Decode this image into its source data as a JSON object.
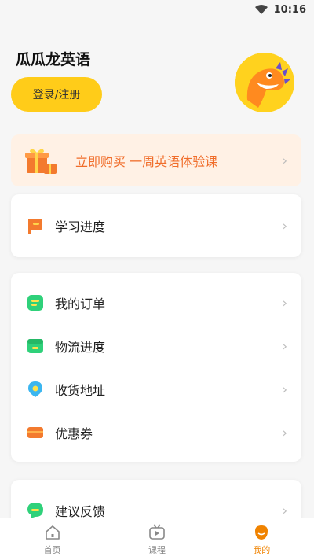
{
  "status": {
    "time": "10:16"
  },
  "header": {
    "app_name": "瓜瓜龙英语",
    "login_label": "登录/注册"
  },
  "promo": {
    "text": "立即购买 一周英语体验课"
  },
  "card1": {
    "items": [
      {
        "label": "学习进度"
      }
    ]
  },
  "card2": {
    "items": [
      {
        "label": "我的订单"
      },
      {
        "label": "物流进度"
      },
      {
        "label": "收货地址"
      },
      {
        "label": "优惠券"
      }
    ]
  },
  "card3": {
    "items": [
      {
        "label": "建议反馈"
      }
    ]
  },
  "tabbar": {
    "tabs": [
      {
        "label": "首页"
      },
      {
        "label": "课程"
      },
      {
        "label": "我的"
      }
    ]
  },
  "colors": {
    "accent": "#ffcc19",
    "promo_text": "#f06d2a",
    "active_tab": "#f08300"
  }
}
